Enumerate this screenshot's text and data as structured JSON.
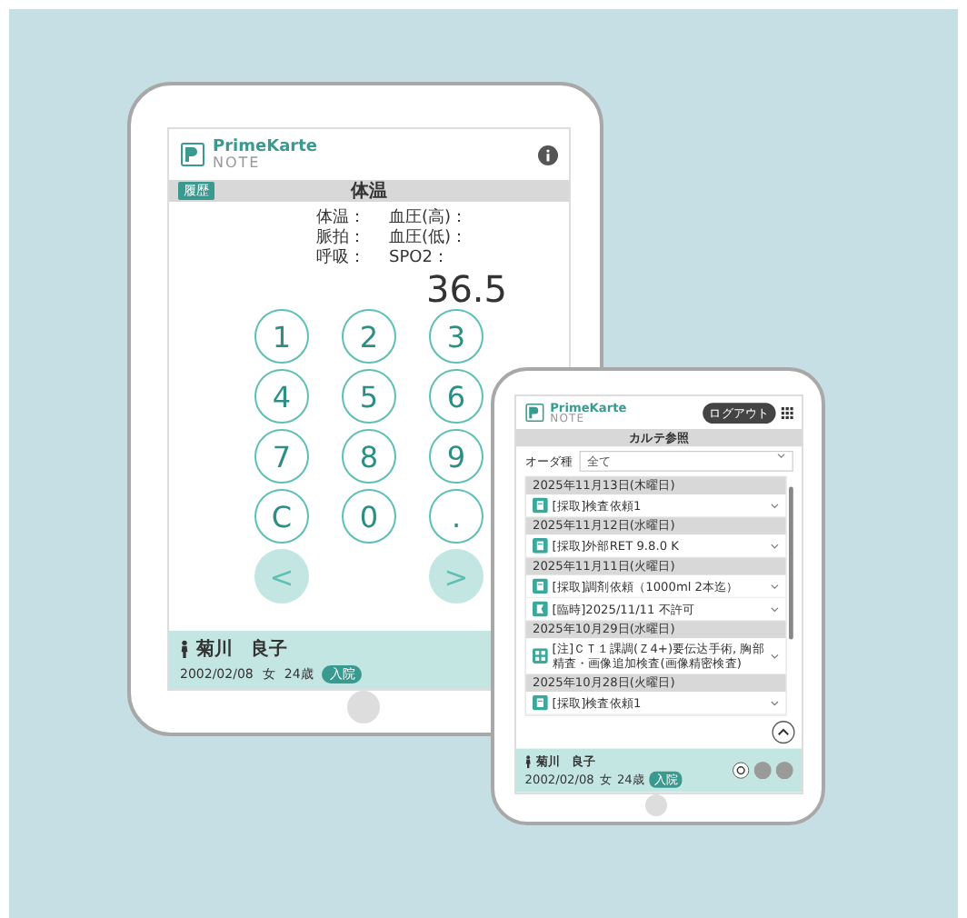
{
  "vitals_tablet": {
    "app_name": "PrimeKarte",
    "app_sub": "NOTE",
    "back_button": "履歴",
    "title": "体温",
    "vital_rows": [
      {
        "left": "体温：",
        "right": "血圧(高)："
      },
      {
        "left": "脈拍：",
        "right": "血圧(低)："
      },
      {
        "left": "呼吸：",
        "right": "SPO2："
      }
    ],
    "reading": "36.5",
    "keys": [
      "1",
      "2",
      "3",
      "4",
      "5",
      "6",
      "7",
      "8",
      "9",
      "C",
      "0",
      "."
    ],
    "nav": [
      "<",
      ">"
    ],
    "patient": {
      "name": "菊川　良子",
      "birth": "2002/02/08",
      "sex": "女",
      "age": "24歳",
      "status": "入院"
    }
  },
  "chart_tablet": {
    "app_name": "PrimeKarte",
    "app_sub": "NOTE",
    "logout": "ログアウト",
    "title": "カルテ参照",
    "filter_label": "オーダ種",
    "filter_value": "全て",
    "days": [
      {
        "date": "2025年11月13日(木曜日)",
        "entries": [
          {
            "kind": "lab",
            "text": "[採取]検査依頼1"
          }
        ]
      },
      {
        "date": "2025年11月12日(水曜日)",
        "entries": [
          {
            "kind": "lab",
            "text": "[採取]外部RET 9.8.0 K"
          }
        ]
      },
      {
        "date": "2025年11月11日(火曜日)",
        "entries": [
          {
            "kind": "lab",
            "text": "[採取]調剤依頼（1000ml 2本迄）"
          },
          {
            "kind": "note",
            "text": "[臨時]2025/11/11 不許可"
          }
        ]
      },
      {
        "date": "2025年10月29日(水曜日)",
        "entries": [
          {
            "kind": "scan",
            "text": "[注]ＣＴ１課調(Ｚ4+)要伝达手術, 胸部精査・画像追加検査(画像精密検査)"
          }
        ]
      },
      {
        "date": "2025年10月28日(火曜日)",
        "entries": [
          {
            "kind": "lab",
            "text": "[採取]検査依頼1"
          }
        ]
      }
    ],
    "patient": {
      "name": "菊川　良子",
      "birth": "2002/02/08",
      "sex": "女",
      "age": "24歳",
      "status": "入院"
    }
  }
}
